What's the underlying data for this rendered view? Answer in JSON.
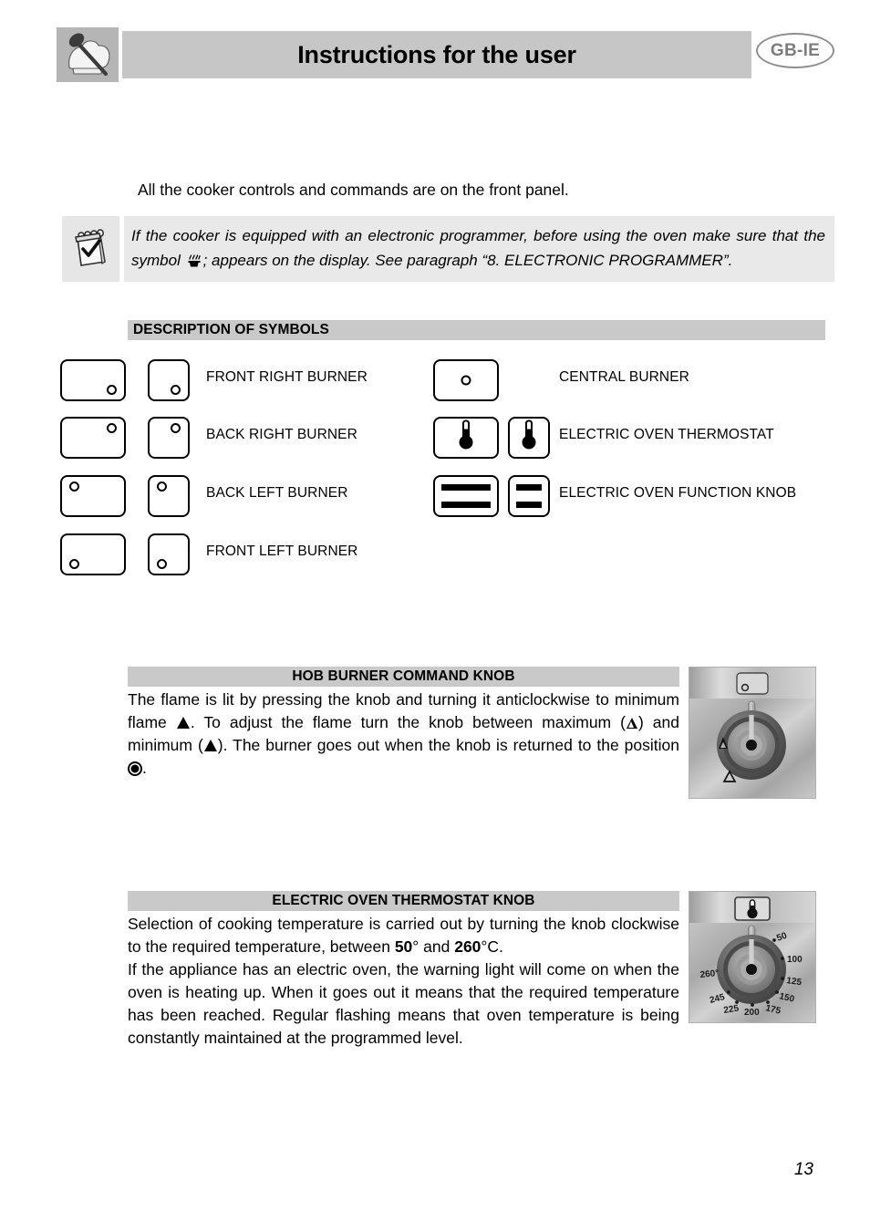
{
  "header": {
    "title": "Instructions for the user",
    "language_badge": "GB-IE",
    "logo_icon": "chef-hat-spoon-icon"
  },
  "intro": {
    "text": "All the cooker controls and commands are on the front panel."
  },
  "note": {
    "icon": "notepad-check-icon",
    "text_before_symbol": "If the cooker is equipped with an electronic programmer, before using the oven make sure that the symbol",
    "symbol_icon": "steam-pot-icon",
    "text_after_symbol": "; appears on the display. See paragraph “8. ELECTRONIC PROGRAMMER”."
  },
  "symbols_section": {
    "title": "DESCRIPTION OF SYMBOLS",
    "left_column": [
      {
        "label": "FRONT RIGHT BURNER",
        "dot": "bottom-right",
        "icon": "burner-knob-front-right-icon"
      },
      {
        "label": "BACK RIGHT BURNER",
        "dot": "top-right",
        "icon": "burner-knob-back-right-icon"
      },
      {
        "label": "BACK LEFT BURNER",
        "dot": "top-left",
        "icon": "burner-knob-back-left-icon"
      },
      {
        "label": "FRONT LEFT BURNER",
        "dot": "bottom-left",
        "icon": "burner-knob-front-left-icon"
      }
    ],
    "right_column": [
      {
        "label": "CENTRAL BURNER",
        "icon": "burner-knob-central-icon",
        "variant": "dot-center",
        "boxes": 1
      },
      {
        "label": "ELECTRIC OVEN THERMOSTAT",
        "icon": "thermostat-icon",
        "variant": "thermometer",
        "boxes": 2
      },
      {
        "label": "ELECTRIC OVEN FUNCTION KNOB",
        "icon": "oven-function-knob-icon",
        "variant": "bars",
        "boxes": 2
      }
    ]
  },
  "hob_block": {
    "title": "HOB BURNER COMMAND KNOB",
    "text_1": "The flame is lit by pressing the knob and turning it anticlockwise to minimum flame",
    "text_2": ". To adjust the flame turn the knob between maximum (",
    "text_3": ") and minimum (",
    "text_4": "). The burner goes out when the knob is returned to the position",
    "text_5": ".",
    "photo": {
      "name": "hob-burner-knob-photo",
      "badge_icon": "burner-knob-symbol-badge",
      "marks": [
        "max-flame-triangle",
        "min-flame-triangle"
      ]
    }
  },
  "thermostat_block": {
    "title": "ELECTRIC OVEN THERMOSTAT KNOB",
    "para_1_a": "Selection of cooking temperature is carried out by turning the knob clockwise to the required temperature, between ",
    "para_1_min": "50",
    "para_1_b": "° and ",
    "para_1_max": "260",
    "para_1_c": "°C.",
    "para_2": "If the appliance has an electric oven, the warning light will come on when the oven is heating up. When it goes out it means that the required temperature has been reached. Regular flashing means that oven temperature is being constantly maintained at the programmed level.",
    "photo": {
      "name": "thermostat-knob-photo",
      "badge_icon": "thermometer-symbol-badge",
      "scale_labels": [
        "50",
        "100",
        "125",
        "150",
        "175",
        "200",
        "225",
        "245",
        "260°"
      ]
    }
  },
  "footer": {
    "page_number": "13"
  },
  "colors": {
    "bar_gray": "#c9c9c9",
    "note_gray": "#e9e9e9",
    "badge_gray": "#7d7d7d",
    "header_gray": "#c6c6c6"
  }
}
